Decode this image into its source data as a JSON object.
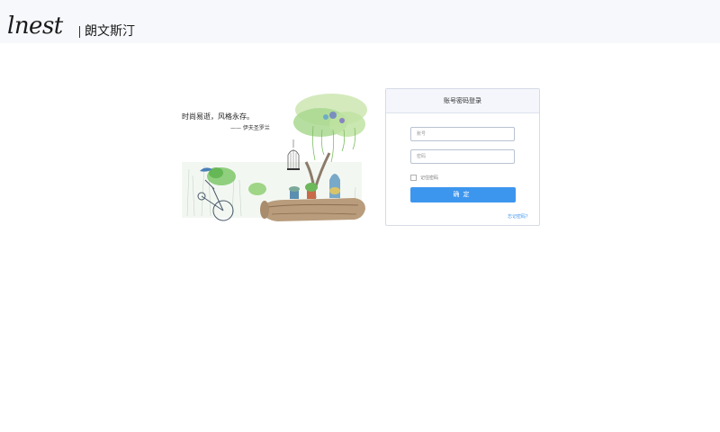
{
  "brand": {
    "script_logo": "lnest",
    "name_cn": "朗文斯汀"
  },
  "illustration": {
    "quote": "时尚易逝，风格永存。",
    "author": "—— 伊夫圣罗兰"
  },
  "login": {
    "title": "账号密码登录",
    "username_placeholder": "账号",
    "password_placeholder": "密码",
    "remember_label": "记住密码",
    "submit_label": "确定",
    "forgot_label": "忘记密码？"
  },
  "colors": {
    "accent": "#3d96ee",
    "header_bg": "#f7f8fc"
  }
}
